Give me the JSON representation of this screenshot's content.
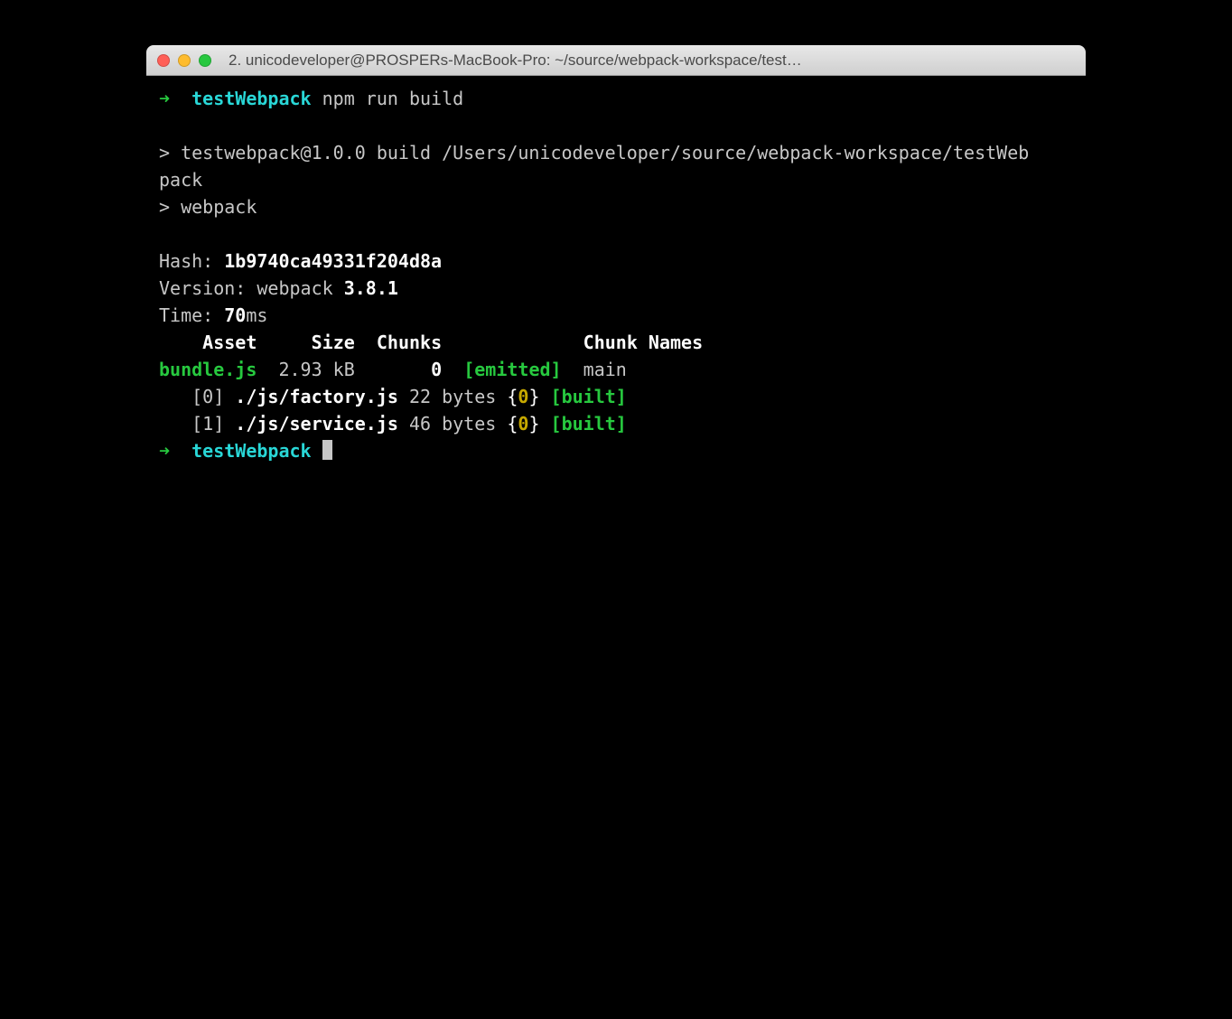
{
  "titlebar": {
    "title": "2. unicodeveloper@PROSPERs-MacBook-Pro: ~/source/webpack-workspace/test…"
  },
  "prompt": {
    "arrow": "➜",
    "dir": "testWebpack",
    "cmd": "npm run build"
  },
  "npm": {
    "line1": "> testwebpack@1.0.0 build /Users/unicodeveloper/source/webpack-workspace/testWeb",
    "line1b": "pack",
    "line2": "> webpack"
  },
  "stats": {
    "hash_label": "Hash: ",
    "hash": "1b9740ca49331f204d8a",
    "version_label": "Version: webpack ",
    "version": "3.8.1",
    "time_label": "Time: ",
    "time": "70",
    "time_unit": "ms"
  },
  "tableHeader": {
    "asset": "Asset",
    "size": "Size",
    "chunks": "Chunks",
    "chunkNames": "Chunk Names"
  },
  "assetRow": {
    "name": "bundle.js",
    "size": "2.93 kB",
    "chunk": "0",
    "flag": "[emitted]",
    "chunkName": "main"
  },
  "modules": [
    {
      "idx": "[0]",
      "path": "./js/factory.js",
      "size": "22 bytes",
      "chunk": "0",
      "flag": "[built]"
    },
    {
      "idx": "[1]",
      "path": "./js/service.js",
      "size": "46 bytes",
      "chunk": "0",
      "flag": "[built]"
    }
  ]
}
